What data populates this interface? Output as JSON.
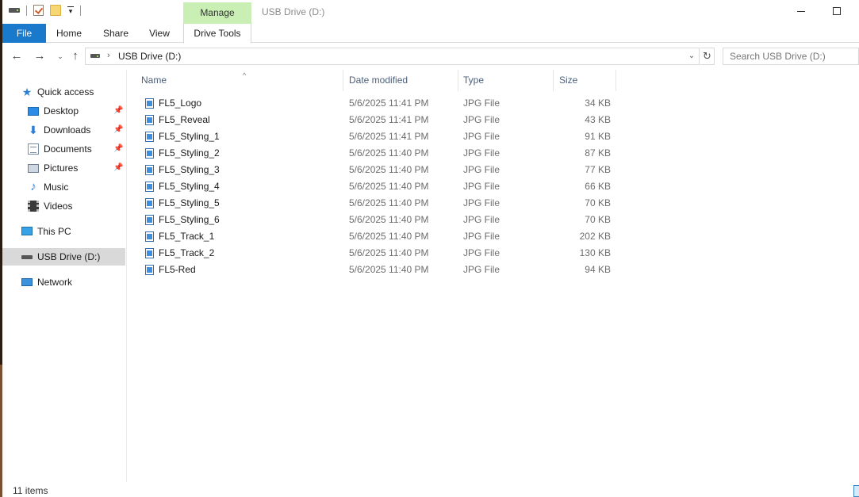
{
  "titlebar": {
    "manage_label": "Manage",
    "window_title": "USB Drive (D:)"
  },
  "ribbon": {
    "tabs": [
      "File",
      "Home",
      "Share",
      "View",
      "Drive Tools"
    ]
  },
  "address": {
    "path": "USB Drive (D:)",
    "search_placeholder": "Search USB Drive (D:)"
  },
  "nav": {
    "quick_access": "Quick access",
    "pinned": [
      "Desktop",
      "Downloads",
      "Documents",
      "Pictures"
    ],
    "unpinned": [
      "Music",
      "Videos"
    ],
    "this_pc": "This PC",
    "usb": "USB Drive (D:)",
    "network": "Network"
  },
  "columns": {
    "name": "Name",
    "date": "Date modified",
    "type": "Type",
    "size": "Size"
  },
  "files": [
    {
      "name": "FL5_Logo",
      "date": "5/6/2025 11:41 PM",
      "type": "JPG File",
      "size": "34 KB"
    },
    {
      "name": "FL5_Reveal",
      "date": "5/6/2025 11:41 PM",
      "type": "JPG File",
      "size": "43 KB"
    },
    {
      "name": "FL5_Styling_1",
      "date": "5/6/2025 11:41 PM",
      "type": "JPG File",
      "size": "91 KB"
    },
    {
      "name": "FL5_Styling_2",
      "date": "5/6/2025 11:40 PM",
      "type": "JPG File",
      "size": "87 KB"
    },
    {
      "name": "FL5_Styling_3",
      "date": "5/6/2025 11:40 PM",
      "type": "JPG File",
      "size": "77 KB"
    },
    {
      "name": "FL5_Styling_4",
      "date": "5/6/2025 11:40 PM",
      "type": "JPG File",
      "size": "66 KB"
    },
    {
      "name": "FL5_Styling_5",
      "date": "5/6/2025 11:40 PM",
      "type": "JPG File",
      "size": "70 KB"
    },
    {
      "name": "FL5_Styling_6",
      "date": "5/6/2025 11:40 PM",
      "type": "JPG File",
      "size": "70 KB"
    },
    {
      "name": "FL5_Track_1",
      "date": "5/6/2025 11:40 PM",
      "type": "JPG File",
      "size": "202 KB"
    },
    {
      "name": "FL5_Track_2",
      "date": "5/6/2025 11:40 PM",
      "type": "JPG File",
      "size": "130 KB"
    },
    {
      "name": "FL5-Red",
      "date": "5/6/2025 11:40 PM",
      "type": "JPG File",
      "size": "94 KB"
    }
  ],
  "status": {
    "item_count": "11 items"
  }
}
